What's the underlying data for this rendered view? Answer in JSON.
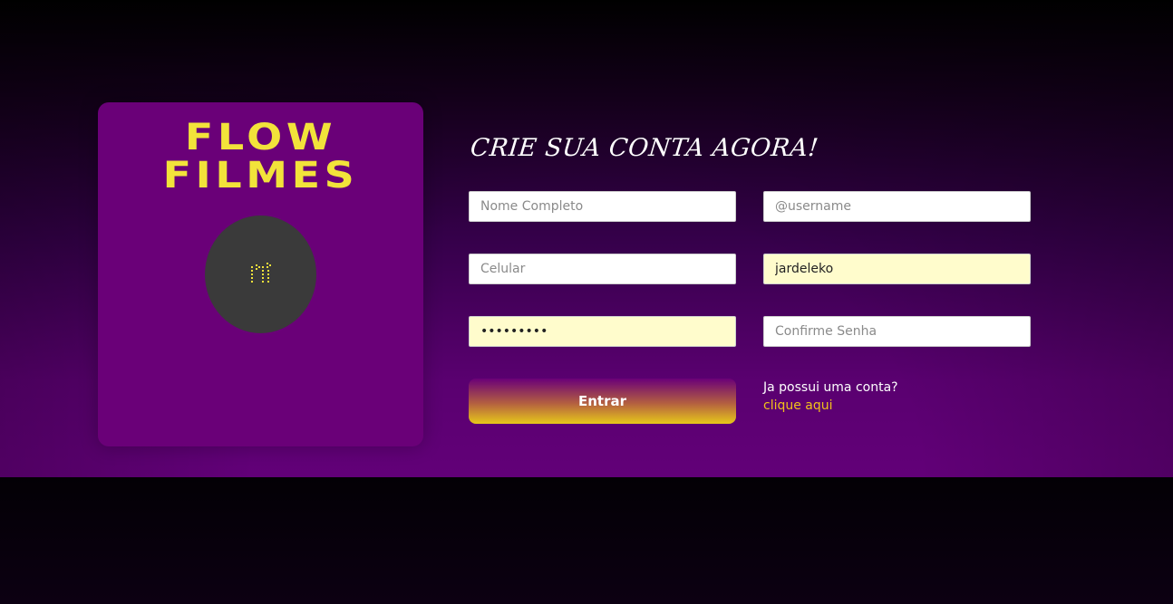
{
  "brand": {
    "line1": "FLOW",
    "line2": "FILMES",
    "accent": "#f2e33a",
    "card_color": "#6a0078"
  },
  "avatar": {
    "icon": "film-reel-icon"
  },
  "form": {
    "title": "CRIE SUA CONTA AGORA!",
    "full_name": {
      "placeholder": "Nome Completo",
      "value": ""
    },
    "username": {
      "placeholder": "@username",
      "value": ""
    },
    "phone": {
      "placeholder": "Celular",
      "value": ""
    },
    "email": {
      "placeholder": "",
      "value": "jardeleko"
    },
    "password": {
      "placeholder": "",
      "value": "jardeleko"
    },
    "confirm_password": {
      "placeholder": "Confirme Senha",
      "value": ""
    },
    "submit_label": "Entrar",
    "login_question": "Ja possui uma conta?",
    "login_link": "clique aqui"
  }
}
